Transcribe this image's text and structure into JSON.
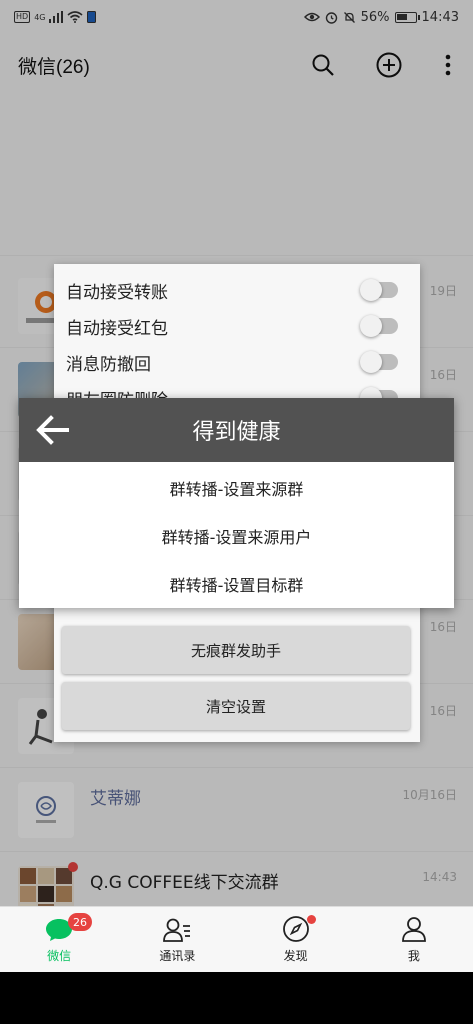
{
  "status_bar": {
    "hd": "HD",
    "signal": "4G",
    "battery_percent": "56%",
    "battery_level": 0.56,
    "time": "14:43"
  },
  "header": {
    "title": "微信(26)",
    "icons": [
      "search-icon",
      "add-circle-icon",
      "more-vertical-icon"
    ]
  },
  "chats": [
    {
      "name": "",
      "time": ""
    },
    {
      "name": "",
      "time": "19日"
    },
    {
      "name": "",
      "time": "16日"
    },
    {
      "name": "",
      "time": ""
    },
    {
      "name": "",
      "time": ""
    },
    {
      "name": "",
      "time": "16日"
    },
    {
      "name": "",
      "time": "16日"
    },
    {
      "name": "艾蒂娜",
      "time": "10月16日"
    },
    {
      "name": "Q.G COFFEE线下交流群",
      "time": "14:43"
    }
  ],
  "settings_panel": {
    "toggles": [
      {
        "label": "自动接受转账",
        "on": false
      },
      {
        "label": "自动接受红包",
        "on": false
      },
      {
        "label": "消息防撤回",
        "on": false
      },
      {
        "label": "朋友圈防删除",
        "on": false
      }
    ],
    "buttons": [
      "无痕群发助手",
      "清空设置"
    ]
  },
  "dialog": {
    "title": "得到健康",
    "items": [
      "群转播-设置来源群",
      "群转播-设置来源用户",
      "群转播-设置目标群"
    ]
  },
  "tabbar": {
    "tabs": [
      {
        "label": "微信",
        "icon": "chat-bubble-icon",
        "badge": "26"
      },
      {
        "label": "通讯录",
        "icon": "contacts-icon"
      },
      {
        "label": "发现",
        "icon": "compass-icon"
      },
      {
        "label": "我",
        "icon": "person-icon"
      }
    ]
  },
  "colors": {
    "accent": "#07c160",
    "badge": "#e64340",
    "dialog_header": "#525252"
  }
}
